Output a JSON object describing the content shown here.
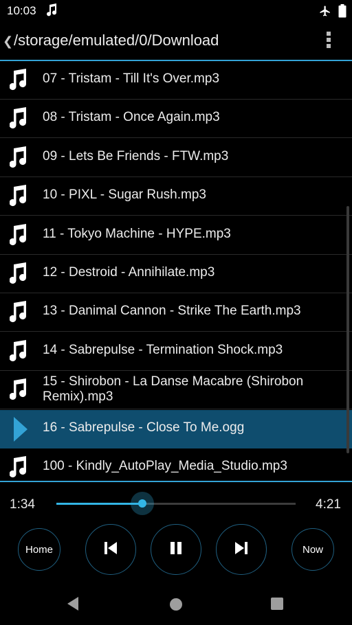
{
  "status_bar": {
    "time": "10:03",
    "icons": [
      "music-note-icon",
      "airplane-mode-icon",
      "battery-icon"
    ]
  },
  "header": {
    "path": "/storage/emulated/0/Download",
    "accent_color": "#33a3d6"
  },
  "file_list": {
    "items": [
      {
        "label": "07 - Tristam - Till It's Over.mp3",
        "icon": "music-note-icon"
      },
      {
        "label": "08 - Tristam - Once Again.mp3",
        "icon": "music-note-icon"
      },
      {
        "label": "09 - Lets Be Friends - FTW.mp3",
        "icon": "music-note-icon"
      },
      {
        "label": "10 - PIXL - Sugar Rush.mp3",
        "icon": "music-note-icon"
      },
      {
        "label": "11 - Tokyo Machine - HYPE.mp3",
        "icon": "music-note-icon"
      },
      {
        "label": "12 - Destroid - Annihilate.mp3",
        "icon": "music-note-icon"
      },
      {
        "label": "13 - Danimal Cannon - Strike The Earth.mp3",
        "icon": "music-note-icon"
      },
      {
        "label": "14 - Sabrepulse - Termination Shock.mp3",
        "icon": "music-note-icon"
      },
      {
        "label": "15 - Shirobon - La Danse Macabre (Shirobon Remix).mp3",
        "icon": "music-note-icon"
      },
      {
        "label": "16 - Sabrepulse - Close To Me.ogg",
        "icon": "play-icon",
        "selected": true
      },
      {
        "label": "100 - Kindly_AutoPlay_Media_Studio.mp3",
        "icon": "music-note-icon"
      }
    ],
    "selected_color": "#0f4d6e"
  },
  "player": {
    "elapsed": "1:34",
    "total": "4:21",
    "progress_fraction": 0.36,
    "home_label": "Home",
    "now_label": "Now",
    "controls": [
      "skip-previous-icon",
      "pause-icon",
      "skip-next-icon"
    ]
  },
  "nav_bar": {
    "icons": [
      "back-icon",
      "home-circle-icon",
      "recents-icon"
    ]
  }
}
